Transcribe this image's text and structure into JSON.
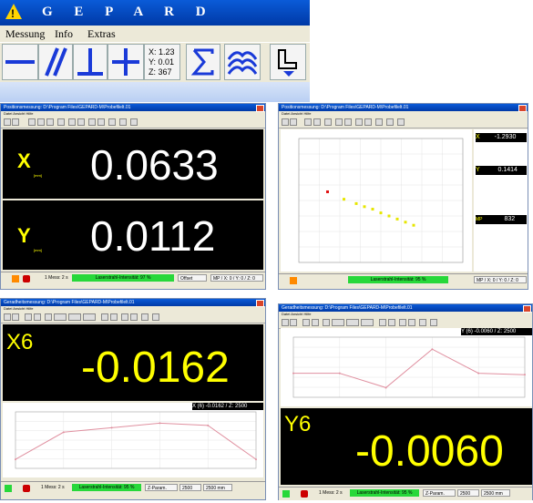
{
  "app": {
    "title": "G E P A R D",
    "menu": [
      "Messung",
      "Info",
      "Extras"
    ],
    "xyz_button": [
      "X: 1.23",
      "Y: 0.01",
      "Z: 367"
    ]
  },
  "windows": {
    "w1": {
      "title": "Positionsmessung: D:\\Program Files\\GEPARD-M\\Probefilelt.01",
      "menu": "Datei  Ansicht  Hilfe",
      "x_label": "X",
      "x_unit": "[mm]",
      "x_value": "0.0633",
      "y_label": "Y",
      "y_unit": "[mm]",
      "y_value": "0.0112",
      "status_left": "1 Mess: 2 s",
      "status_green": "Laserstrahl-Intensität: 97 %",
      "status_offset": "Offset",
      "status_mp": "MP / X: 0 / Y: 0 / Z: 0"
    },
    "w2": {
      "title": "Positionsmessung: D:\\Program Files\\GEPARD-M\\Probefilelt.01",
      "menu": "Datei  Ansicht  Hilfe",
      "x_readout_label": "X",
      "x_readout": "-1.2930",
      "y_readout_label": "Y",
      "y_readout": "0.1414",
      "z_readout_label": "MP",
      "z_readout": "832",
      "status_green": "Laserstrahl-Intensität: 95 %",
      "status_mp": "MP / X: 0 / Y: 0 / Z: 0"
    },
    "w3": {
      "title": "Geradheitsmessung: D:\\Program Files\\GEPARD-M\\Probefilelt.01",
      "menu": "Datei  Ansicht  Hilfe",
      "big_label": "X6",
      "big_value": "-0.0162",
      "readout": "X (6)    -0.0162 / Z:    2500",
      "status_left": "1 Mess: 2 s",
      "status_green": "Laserstrahl-Intensität: 95 %",
      "status_param": "Z-Param.",
      "status_2500": "2500",
      "status_mm": "2500 mm"
    },
    "w4": {
      "title": "Geradheitsmessung: D:\\Program Files\\GEPARD-M\\Probefilelt.01",
      "menu": "Datei  Ansicht  Hilfe",
      "big_label": "Y6",
      "big_value": "-0.0060",
      "readout": "Y (6)    -0.0060 / Z:    2500",
      "status_left": "1 Mess: 2 s",
      "status_green": "Laserstrahl-Intensität: 95 %",
      "status_param": "Z-Param.",
      "status_2500": "2500",
      "status_mm": "2500 mm"
    }
  },
  "chart_data": [
    {
      "type": "scatter",
      "title": "",
      "series": [
        {
          "values": [
            [
              -1.3,
              0.14
            ]
          ]
        },
        {
          "values": [
            [
              -0.9,
              0.02
            ],
            [
              -0.6,
              -0.05
            ],
            [
              -0.4,
              -0.1
            ],
            [
              -0.2,
              -0.14
            ],
            [
              0.0,
              -0.2
            ],
            [
              0.2,
              -0.25
            ],
            [
              0.4,
              -0.3
            ],
            [
              0.6,
              -0.35
            ],
            [
              0.8,
              -0.4
            ]
          ]
        }
      ],
      "colors": [
        "#e01010",
        "#e6e600"
      ]
    },
    {
      "type": "line",
      "x": [
        0,
        500,
        1000,
        1500,
        2000,
        2500
      ],
      "values": [
        -0.16,
        -0.04,
        -0.02,
        0.0,
        -0.01,
        -0.16
      ],
      "color": "#e090a0"
    },
    {
      "type": "line",
      "x": [
        0,
        500,
        1000,
        1500,
        2000,
        2500
      ],
      "values": [
        0.0,
        0.0,
        -0.06,
        0.1,
        0.0,
        -0.006
      ],
      "color": "#e090a0"
    }
  ]
}
